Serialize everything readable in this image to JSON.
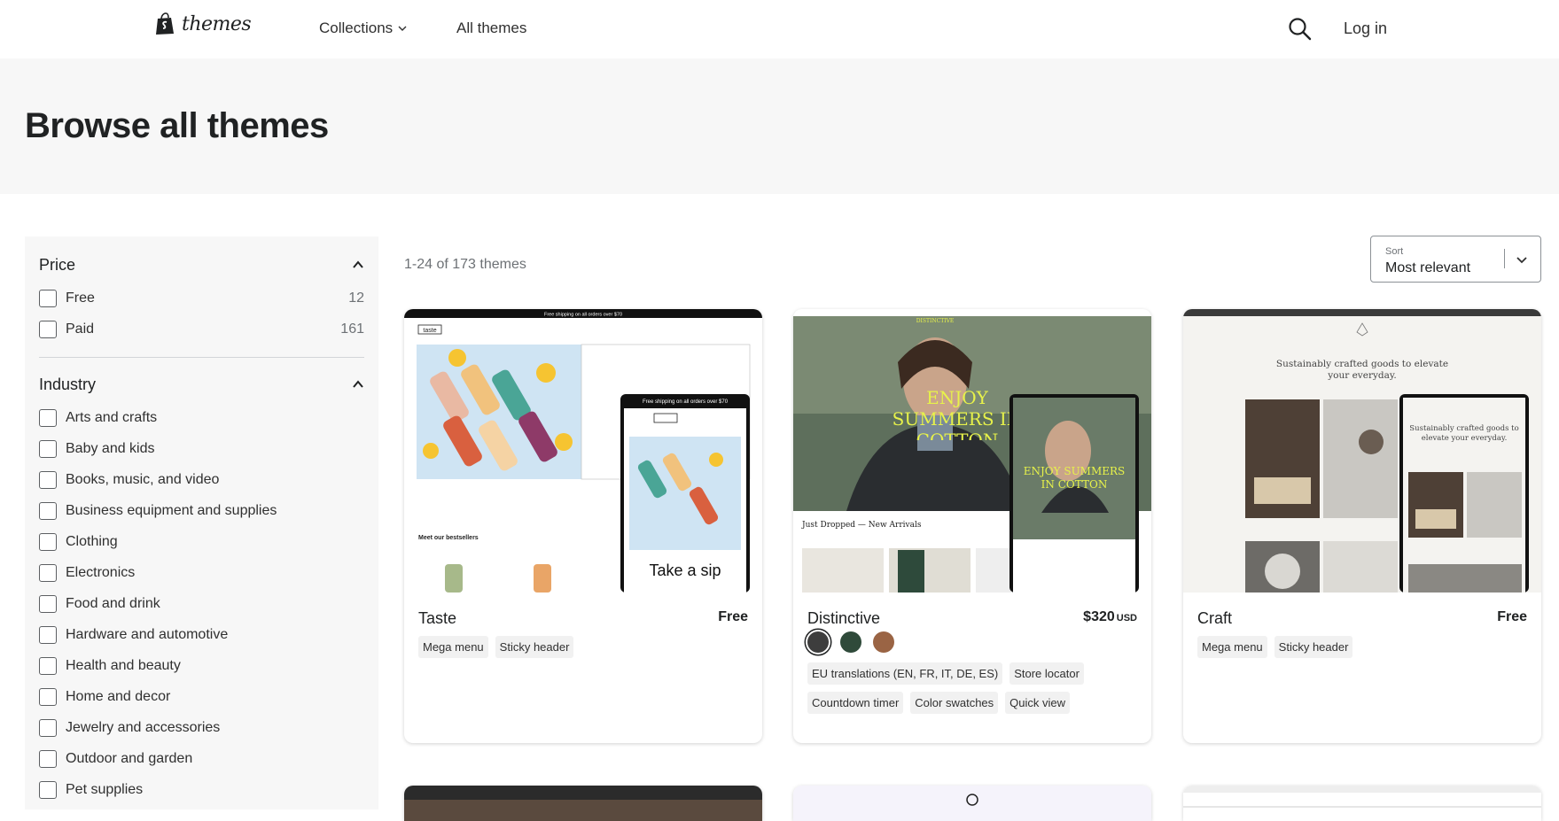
{
  "nav": {
    "logo_text": "themes",
    "collections": "Collections",
    "all_themes": "All themes",
    "login": "Log in"
  },
  "hero": {
    "title": "Browse all themes"
  },
  "filters": {
    "price": {
      "title": "Price",
      "options": [
        {
          "label": "Free",
          "count": "12"
        },
        {
          "label": "Paid",
          "count": "161"
        }
      ]
    },
    "industry": {
      "title": "Industry",
      "options": [
        "Arts and crafts",
        "Baby and kids",
        "Books, music, and video",
        "Business equipment and supplies",
        "Clothing",
        "Electronics",
        "Food and drink",
        "Hardware and automotive",
        "Health and beauty",
        "Home and decor",
        "Jewelry and accessories",
        "Outdoor and garden",
        "Pet supplies"
      ]
    }
  },
  "results": {
    "text": "1-24 of 173 themes"
  },
  "sort": {
    "caption": "Sort",
    "value": "Most relevant"
  },
  "themes": [
    {
      "name": "Taste",
      "price": "Free",
      "tags": [
        "Mega menu",
        "Sticky header"
      ],
      "preview": {
        "banner": "Free shipping on all orders over $70",
        "logo": "taste",
        "section": "Meet our bestsellers",
        "mobile_banner": "Free shipping on all orders over $70",
        "mobile_cta": "Take a sip"
      }
    },
    {
      "name": "Distinctive",
      "price": "$320",
      "currency": "USD",
      "swatch_colors": [
        "#3d3d3d",
        "#2f4a3a",
        "#9a6444"
      ],
      "tags": [
        "EU translations (EN, FR, IT, DE, ES)",
        "Store locator",
        "Countdown timer",
        "Color swatches",
        "Quick view"
      ],
      "preview": {
        "brand": "DISTINCTIVE",
        "headline": "ENJOY SUMMERS IN COTTON",
        "mobile_headline": "ENJOY SUMMERS IN COTTON",
        "section": "Just Dropped — New Arrivals"
      }
    },
    {
      "name": "Craft",
      "price": "Free",
      "tags": [
        "Mega menu",
        "Sticky header"
      ],
      "preview": {
        "headline": "Sustainably crafted goods to elevate your everyday.",
        "mobile_headline": "Sustainably crafted goods to elevate your everyday."
      }
    }
  ],
  "colors": {
    "hero_bg": "#f7f7f7",
    "sidebar_bg": "#f7f7f7",
    "text": "#202223",
    "muted": "#6d7175"
  }
}
